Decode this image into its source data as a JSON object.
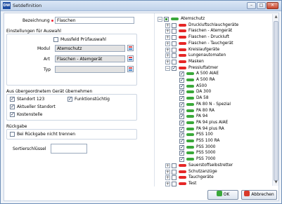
{
  "window": {
    "app_icon": "DW",
    "title": "Setdefinition",
    "buttons": [
      "–",
      "□",
      "✕"
    ]
  },
  "form": {
    "bezeichnung_label": "Bezeichnung",
    "bezeichnung_value": "Flaschen",
    "auswahl_group": "Einstellungen für Auswahl",
    "mussfeld_label": "Mussfeld Prüfauswahl",
    "modul_label": "Modul",
    "modul_value": "Atemschutz",
    "art_label": "Art",
    "art_value": "Flaschen - Atemgerät",
    "typ_label": "Typ",
    "typ_value": "",
    "uebernehmen_group": "Aus übergeordnetem Gerät übernehmen",
    "standort_label": "Standort 123",
    "funktion_label": "Funktionstüchtig",
    "aktueller_label": "Aktueller Standort",
    "kosten_label": "Kostenstelle",
    "rueckgabe_group": "Rückgabe",
    "rueckgabe_label": "Bei Rückgabe nicht trennen",
    "sort_label": "Sortierschlüssel",
    "sort_value": ""
  },
  "tree": {
    "items": [
      {
        "label": "Atemschutz",
        "level": 0,
        "expander": "−",
        "check": "part",
        "icon": "green"
      },
      {
        "label": "Druckluftschlauchgeräte",
        "level": 1,
        "expander": "+",
        "check": "off",
        "icon": "red"
      },
      {
        "label": "Flaschen - Atemgerät",
        "level": 1,
        "expander": "+",
        "check": "off",
        "icon": "red"
      },
      {
        "label": "Flaschen - Druckluft",
        "level": 1,
        "expander": "+",
        "check": "off",
        "icon": "red"
      },
      {
        "label": "Flaschen - Tauchgerät",
        "level": 1,
        "expander": "+",
        "check": "off",
        "icon": "red"
      },
      {
        "label": "Kreislaufgeräte",
        "level": 1,
        "expander": "+",
        "check": "off",
        "icon": "red"
      },
      {
        "label": "Lungenautomaten",
        "level": 1,
        "expander": "+",
        "check": "off",
        "icon": "red"
      },
      {
        "label": "Masken",
        "level": 1,
        "expander": "+",
        "check": "off",
        "icon": "red"
      },
      {
        "label": "Pressluftatmer",
        "level": 1,
        "expander": "−",
        "check": "on",
        "icon": "red"
      },
      {
        "label": "A 500 AIAE",
        "level": 2,
        "expander": "",
        "check": "on",
        "icon": "green"
      },
      {
        "label": "A 500 RA",
        "level": 2,
        "expander": "",
        "check": "on",
        "icon": "green"
      },
      {
        "label": "A500",
        "level": 2,
        "expander": "",
        "check": "on",
        "icon": "green"
      },
      {
        "label": "DA 300",
        "level": 2,
        "expander": "",
        "check": "on",
        "icon": "green"
      },
      {
        "label": "DA 58",
        "level": 2,
        "expander": "",
        "check": "on",
        "icon": "green"
      },
      {
        "label": "PA 80 N - Spezial",
        "level": 2,
        "expander": "",
        "check": "on",
        "icon": "green"
      },
      {
        "label": "PA 80 RA",
        "level": 2,
        "expander": "",
        "check": "on",
        "icon": "green"
      },
      {
        "label": "PA 94",
        "level": 2,
        "expander": "",
        "check": "on",
        "icon": "green"
      },
      {
        "label": "PA 94 plus AIAE",
        "level": 2,
        "expander": "",
        "check": "on",
        "icon": "green"
      },
      {
        "label": "PA 94 plus RA",
        "level": 2,
        "expander": "",
        "check": "on",
        "icon": "green"
      },
      {
        "label": "PSS 100",
        "level": 2,
        "expander": "",
        "check": "on",
        "icon": "green"
      },
      {
        "label": "PSS 100 RA",
        "level": 2,
        "expander": "",
        "check": "on",
        "icon": "green"
      },
      {
        "label": "PSS 3000",
        "level": 2,
        "expander": "",
        "check": "on",
        "icon": "green"
      },
      {
        "label": "PSS 5000",
        "level": 2,
        "expander": "",
        "check": "on",
        "icon": "green"
      },
      {
        "label": "PSS 7000",
        "level": 2,
        "expander": "",
        "check": "on",
        "icon": "green"
      },
      {
        "label": "Sauerstoffselbstretter",
        "level": 1,
        "expander": "+",
        "check": "off",
        "icon": "red"
      },
      {
        "label": "Schutzanzüge",
        "level": 1,
        "expander": "+",
        "check": "off",
        "icon": "red"
      },
      {
        "label": "Tauchgeräte",
        "level": 1,
        "expander": "+",
        "check": "off",
        "icon": "red"
      },
      {
        "label": "Test",
        "level": 1,
        "expander": "+",
        "check": "off",
        "icon": "red"
      }
    ]
  },
  "buttons": {
    "ok": "OK",
    "cancel": "Abbrechen"
  },
  "colors": {
    "ok_icon": "#3aa83a",
    "cancel_icon": "#d93a2b"
  }
}
